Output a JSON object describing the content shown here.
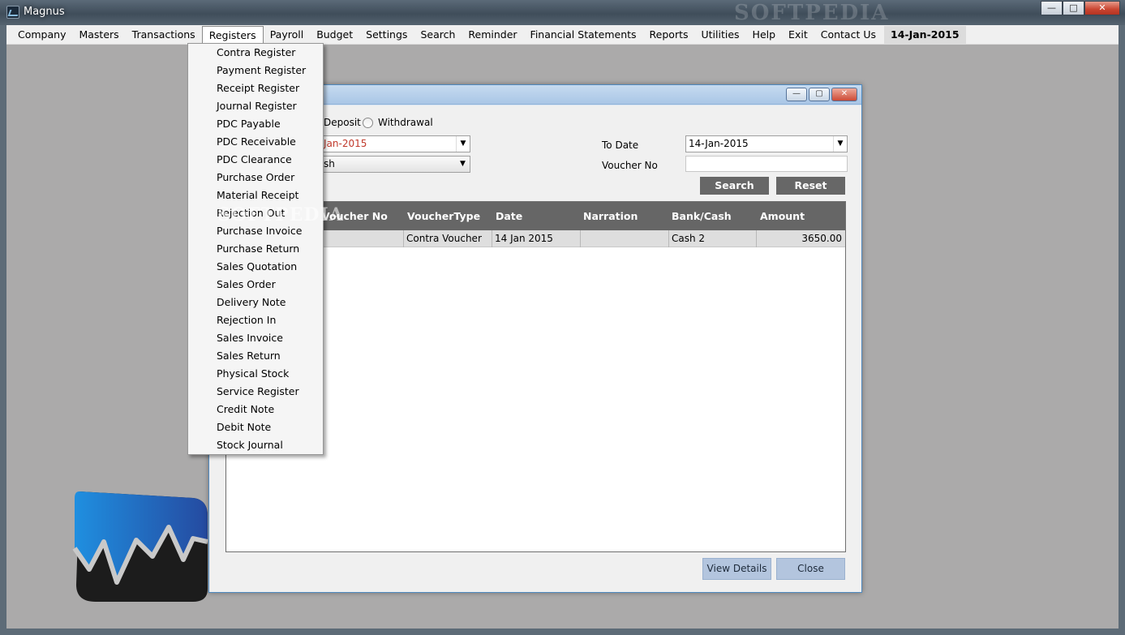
{
  "window": {
    "title": "Magnus",
    "watermark": "SOFTPEDIA",
    "buttons": {
      "minimize": "—",
      "maximize": "□",
      "close": "✕"
    }
  },
  "menubar": {
    "items": [
      "Company",
      "Masters",
      "Transactions",
      "Registers",
      "Payroll",
      "Budget",
      "Settings",
      "Search",
      "Reminder",
      "Financial Statements",
      "Reports",
      "Utilities",
      "Help",
      "Exit",
      "Contact Us"
    ],
    "active": "Registers",
    "date": "14-Jan-2015"
  },
  "registers_menu": {
    "items": [
      "Contra Register",
      "Payment Register",
      "Receipt Register",
      "Journal Register",
      "PDC Payable",
      "PDC Receivable",
      "PDC Clearance",
      "Purchase Order",
      "Material Receipt",
      "Rejection Out",
      "Purchase Invoice",
      "Purchase Return",
      "Sales Quotation",
      "Sales Order",
      "Delivery Note",
      "Rejection In",
      "Sales Invoice",
      "Sales Return",
      "Physical Stock",
      "Service Register",
      "Credit Note",
      "Debit Note",
      "Stock Journal"
    ],
    "watermark": "SOFTPEDIA"
  },
  "child": {
    "buttons": {
      "minimize": "—",
      "maximize": "▢",
      "close": "✕"
    },
    "radios": {
      "deposit": "Deposit",
      "withdrawal": "Withdrawal"
    },
    "from_date_value": "Jan-2015",
    "cash_value": "sh",
    "to_date_label": "To Date",
    "to_date_value": "14-Jan-2015",
    "voucher_no_label": "Voucher No",
    "voucher_no_value": "",
    "search_button": "Search",
    "reset_button": "Reset",
    "grid": {
      "columns": [
        "Voucher No",
        "VoucherType",
        "Date",
        "Narration",
        "Bank/Cash",
        "Amount"
      ],
      "rows": [
        {
          "voucher_no": "",
          "voucher_type": "Contra Voucher",
          "date": "14 Jan 2015",
          "narration": "",
          "bank_cash": "Cash 2",
          "amount": "3650.00"
        }
      ]
    },
    "view_details_button": "View Details",
    "close_button": "Close"
  },
  "colors": {
    "mdi_background": "#abaaaa",
    "grid_header": "#666666",
    "action_button": "#676767",
    "footer_button": "#b3c5de",
    "from_date_text": "#c0392b"
  }
}
